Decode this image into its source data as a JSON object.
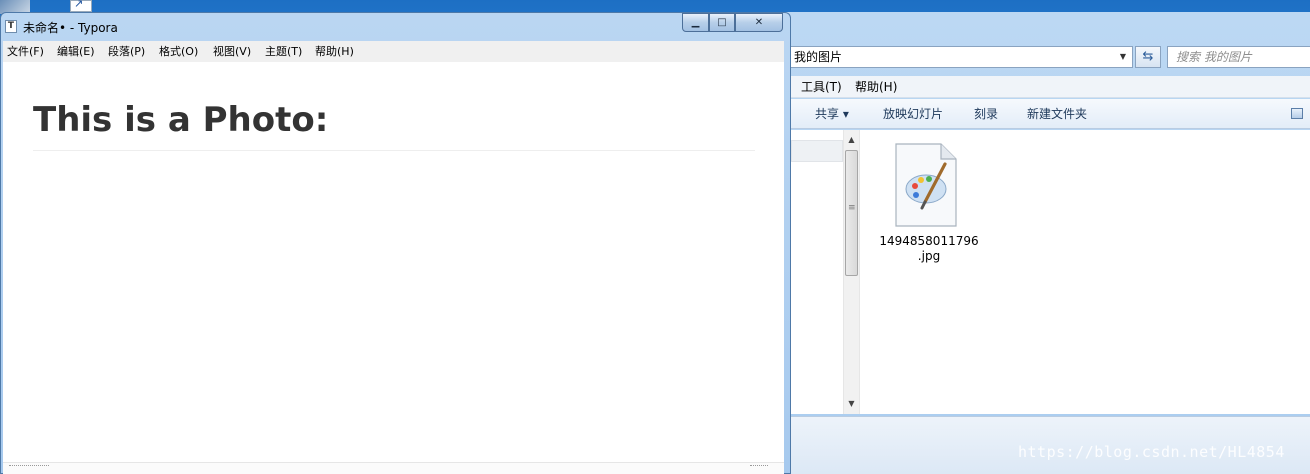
{
  "typora": {
    "title": "未命名• - Typora",
    "icon_letter": "T",
    "menu": [
      "文件(F)",
      "编辑(E)",
      "段落(P)",
      "格式(O)",
      "视图(V)",
      "主题(T)",
      "帮助(H)"
    ],
    "heading": "This is a Photo:",
    "caption_buttons": {
      "minimize": "▁",
      "maximize": "□",
      "close": "✕"
    }
  },
  "explorer": {
    "address": "我的图片",
    "search_placeholder": "搜索 我的图片",
    "menu": [
      "工具(T)",
      "帮助(H)"
    ],
    "toolbar": [
      "共享 ▾",
      "放映幻灯片",
      "刻录",
      "新建文件夹"
    ],
    "file": {
      "name_line1": "1494858011796",
      "name_line2": ".jpg"
    }
  },
  "watermark": "https://blog.csdn.net/HL4854"
}
